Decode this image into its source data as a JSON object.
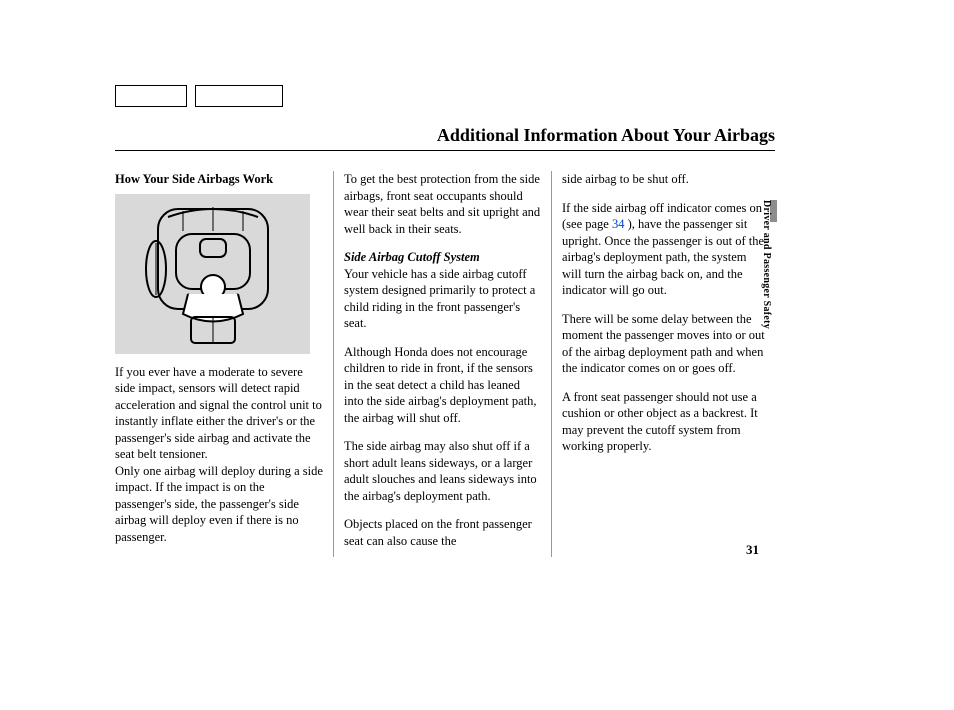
{
  "header": {
    "title": "Additional Information About Your Airbags"
  },
  "sideTab": {
    "label": "Driver and Passenger Safety"
  },
  "pageNumber": "31",
  "col1": {
    "subhead": "How Your Side Airbags Work",
    "p1": "If you ever have a moderate to severe side impact, sensors will detect rapid acceleration and signal the control unit to instantly inflate either the driver's or the passenger's side airbag and activate the seat belt tensioner.",
    "p2": "Only one airbag will deploy during a side impact. If the impact is on the passenger's side, the passenger's side airbag will deploy even if there is no passenger."
  },
  "col2": {
    "p1": "To get the best protection from the side airbags, front seat occupants should wear their seat belts and sit upright and well back in their seats.",
    "subhead2": "Side Airbag Cutoff System",
    "p2": "Your vehicle has a side airbag cutoff system designed primarily to protect a child riding in the front passenger's seat.",
    "p3": "Although Honda does not encourage children to ride in front, if the sensors in the seat detect a child has leaned into the side airbag's deployment path, the airbag will shut off.",
    "p4": "The side airbag may also shut off if a short adult leans sideways, or a larger adult slouches and leans sideways into the airbag's deployment path.",
    "p5": "Objects placed on the front passenger seat can also cause the"
  },
  "col3": {
    "p1": "side airbag to be shut off.",
    "p2a": "If the side airbag off indicator comes on (see page ",
    "p2link": "34",
    "p2b": " ), have the passenger sit upright. Once the passenger is out of the airbag's deployment path, the system will turn the airbag back on, and the indicator will go out.",
    "p3": "There will be some delay between the moment the passenger moves into or out of the airbag deployment path and when the indicator comes on or goes off.",
    "p4": "A front seat passenger should not use a cushion or other object as a backrest. It may prevent the cutoff system from working properly."
  }
}
